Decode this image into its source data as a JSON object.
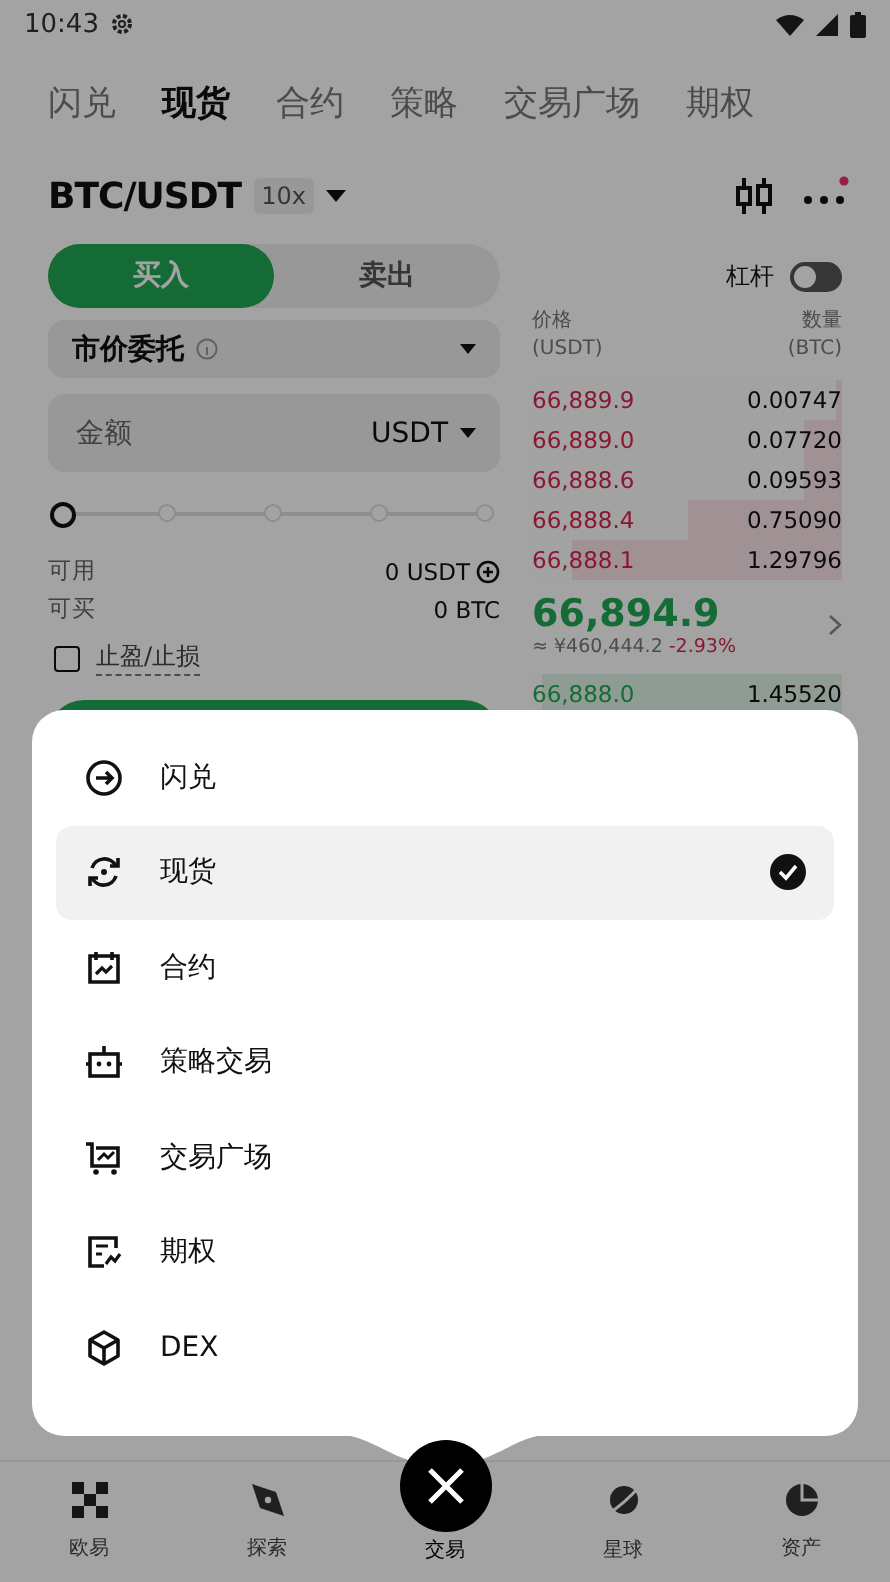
{
  "status_bar": {
    "time": "10:43"
  },
  "top_tabs": [
    {
      "label": "闪兑",
      "selected": false
    },
    {
      "label": "现货",
      "selected": true
    },
    {
      "label": "合约",
      "selected": false
    },
    {
      "label": "策略",
      "selected": false
    },
    {
      "label": "交易广场",
      "selected": false
    },
    {
      "label": "期权",
      "selected": false
    }
  ],
  "pair": {
    "symbol": "BTC/USDT",
    "leverage": "10x"
  },
  "side_tabs": [
    {
      "label": "买入",
      "selected": true
    },
    {
      "label": "卖出",
      "selected": false
    }
  ],
  "order_type": "市价委托",
  "amount": {
    "placeholder": "金额",
    "unit": "USDT"
  },
  "slider": {
    "level": 0
  },
  "available": {
    "label": "可用",
    "value": "0 USDT"
  },
  "can_buy": {
    "label": "可买",
    "value": "0 BTC"
  },
  "tp_sl": {
    "label": "止盈/止损",
    "checked": false
  },
  "margin": {
    "label": "杠杆",
    "on": false
  },
  "order_book": {
    "price_header": [
      "价格",
      "(USDT)"
    ],
    "qty_header": [
      "数量",
      "(BTC)"
    ],
    "asks": [
      {
        "price": "66,889.9",
        "qty": "0.00747",
        "level": 0.02
      },
      {
        "price": "66,889.0",
        "qty": "0.07720",
        "level": 0.12
      },
      {
        "price": "66,888.6",
        "qty": "0.09593",
        "level": 0.12
      },
      {
        "price": "66,888.4",
        "qty": "0.75090",
        "level": 0.5
      },
      {
        "price": "66,888.1",
        "qty": "1.29796",
        "level": 0.87
      }
    ],
    "last_price": "66,894.9",
    "cny": "≈ ¥460,444.2",
    "change": "-2.93%",
    "bids": [
      {
        "price": "66,888.0",
        "qty": "1.45520",
        "level": 0.97
      }
    ]
  },
  "menu": [
    {
      "label": "闪兑",
      "kind": "swap",
      "selected": false
    },
    {
      "label": "现货",
      "kind": "spot",
      "selected": true
    },
    {
      "label": "合约",
      "kind": "contract",
      "selected": false
    },
    {
      "label": "策略交易",
      "kind": "bot",
      "selected": false
    },
    {
      "label": "交易广场",
      "kind": "cart",
      "selected": false
    },
    {
      "label": "期权",
      "kind": "option",
      "selected": false
    },
    {
      "label": "DEX",
      "kind": "cube",
      "selected": false
    }
  ],
  "bottom_nav": [
    {
      "label": "欧易",
      "kind": "logo",
      "selected": false
    },
    {
      "label": "探索",
      "kind": "compass",
      "selected": false
    },
    {
      "label": "交易",
      "kind": "close",
      "selected": true
    },
    {
      "label": "星球",
      "kind": "planet",
      "selected": false
    },
    {
      "label": "资产",
      "kind": "pie",
      "selected": false
    }
  ]
}
